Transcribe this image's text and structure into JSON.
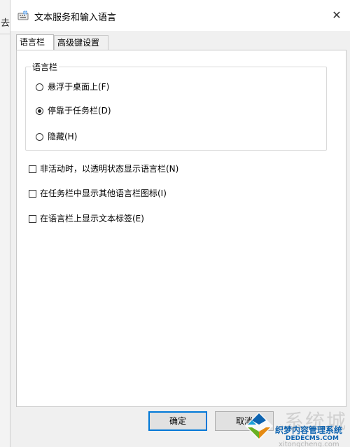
{
  "behind_window": {
    "partial_char": "去"
  },
  "dialog": {
    "title": "文本服务和输入语言",
    "close_symbol": "✕",
    "tabs": [
      {
        "label": "语言栏"
      },
      {
        "label": "高级键设置"
      }
    ],
    "group_title": "语言栏",
    "radios": [
      {
        "label": "悬浮于桌面上(F)",
        "checked": false
      },
      {
        "label": "停靠于任务栏(D)",
        "checked": true
      },
      {
        "label": "隐藏(H)",
        "checked": false
      }
    ],
    "checkboxes": [
      {
        "label": "非活动时，以透明状态显示语言栏(N)",
        "checked": false
      },
      {
        "label": "在任务栏中显示其他语言栏图标(I)",
        "checked": false
      },
      {
        "label": "在语言栏上显示文本标签(E)",
        "checked": false
      }
    ],
    "buttons": {
      "ok": "确定",
      "cancel": "取消"
    }
  },
  "watermark": {
    "big": "系统城",
    "cn": "织梦内容管理系统",
    "en": "DEDECMS.COM",
    "url_faint": "xitongcheng.com",
    "url": "xitongcheng.com",
    "colors": {
      "blue": "#0d63b0",
      "green": "#6ab023",
      "orange": "#e58a12"
    }
  }
}
